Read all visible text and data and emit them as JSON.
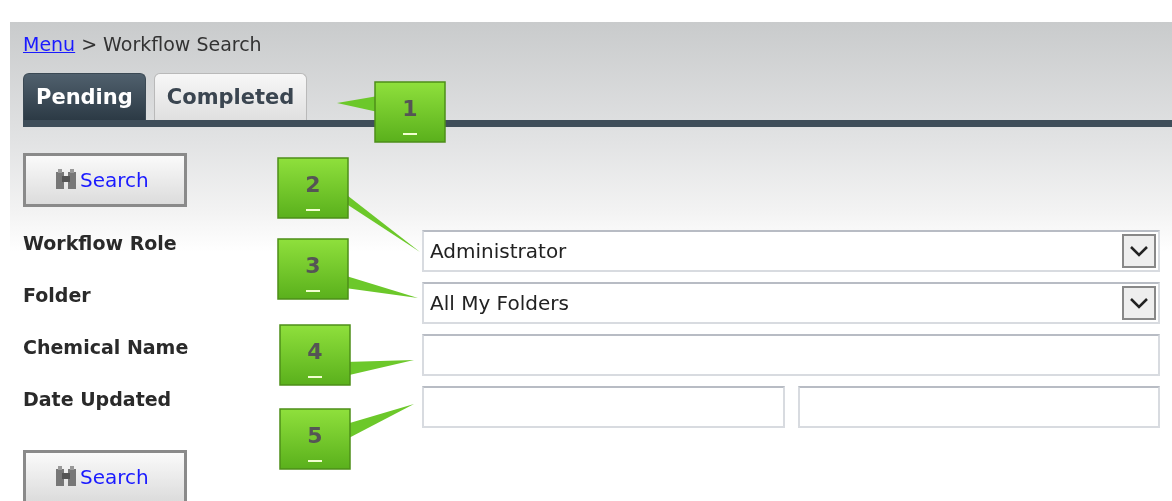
{
  "breadcrumb": {
    "link": "Menu",
    "separator": ">",
    "current": "Workflow Search"
  },
  "tabs": [
    {
      "label": "Pending",
      "selected": true
    },
    {
      "label": "Completed",
      "selected": false
    }
  ],
  "top_search_button": "Search",
  "fields": [
    {
      "label": "Workflow Role",
      "kind": "select",
      "value": "Administrator"
    },
    {
      "label": "Folder",
      "kind": "select",
      "value": "All My Folders"
    },
    {
      "label": "Chemical Name",
      "kind": "text"
    },
    {
      "label": "Date Updated",
      "kind": "date_range"
    }
  ],
  "bottom_search_button": "Search",
  "callouts": [
    "1",
    "2",
    "3",
    "4",
    "5"
  ]
}
